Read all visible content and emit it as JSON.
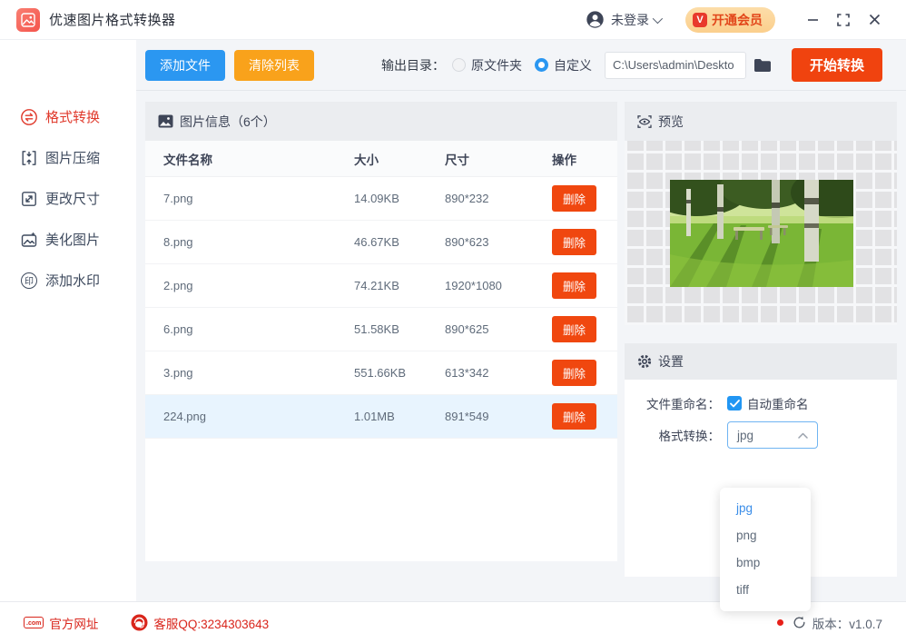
{
  "titlebar": {
    "app_title": "优速图片格式转换器",
    "login_label": "未登录",
    "vip_label": "开通会员",
    "vip_badge": "V"
  },
  "sidebar": {
    "items": [
      {
        "label": "格式转换",
        "icon": "format-convert-icon",
        "active": true
      },
      {
        "label": "图片压缩",
        "icon": "image-compress-icon",
        "active": false
      },
      {
        "label": "更改尺寸",
        "icon": "resize-icon",
        "active": false
      },
      {
        "label": "美化图片",
        "icon": "beautify-icon",
        "active": false
      },
      {
        "label": "添加水印",
        "icon": "watermark-icon",
        "active": false
      }
    ],
    "watermark_glyph": "印"
  },
  "toolbar": {
    "add_files_label": "添加文件",
    "clear_list_label": "清除列表",
    "output_dir_label": "输出目录：",
    "radio_original_label": "原文件夹",
    "radio_custom_label": "自定义",
    "radio_selected": "自定义",
    "output_path_value": "C:\\Users\\admin\\Deskto",
    "start_label": "开始转换"
  },
  "file_panel": {
    "header": "图片信息（6个）",
    "columns": [
      "文件名称",
      "大小",
      "尺寸",
      "操作"
    ],
    "delete_label": "删除",
    "rows": [
      {
        "name": "7.png",
        "size": "14.09KB",
        "dims": "890*232",
        "selected": false
      },
      {
        "name": "8.png",
        "size": "46.67KB",
        "dims": "890*623",
        "selected": false
      },
      {
        "name": "2.png",
        "size": "74.21KB",
        "dims": "1920*1080",
        "selected": false
      },
      {
        "name": "6.png",
        "size": "51.58KB",
        "dims": "890*625",
        "selected": false
      },
      {
        "name": "3.png",
        "size": "551.66KB",
        "dims": "613*342",
        "selected": false
      },
      {
        "name": "224.png",
        "size": "1.01MB",
        "dims": "891*549",
        "selected": true
      }
    ]
  },
  "preview_panel": {
    "header": "预览"
  },
  "settings_panel": {
    "header": "设置",
    "rename_label": "文件重命名：",
    "rename_checkbox_label": "自动重命名",
    "rename_checked": true,
    "format_label": "格式转换：",
    "format_value": "jpg",
    "format_options": [
      "jpg",
      "png",
      "bmp",
      "tiff"
    ]
  },
  "statusbar": {
    "website_label": "官方网址",
    "com_icon_text": ".com",
    "qq_label": "客服QQ:3234303643",
    "version_label": "版本：v1.0.7"
  },
  "colors": {
    "accent_blue": "#2b97f1",
    "accent_orange": "#f9a21b",
    "accent_red": "#f0430f",
    "sidebar_active_red": "#e03a2c",
    "link_red": "#d9261c",
    "selected_row_bg": "#e8f4fe",
    "vip_pill_bg": "#fbd49b"
  }
}
